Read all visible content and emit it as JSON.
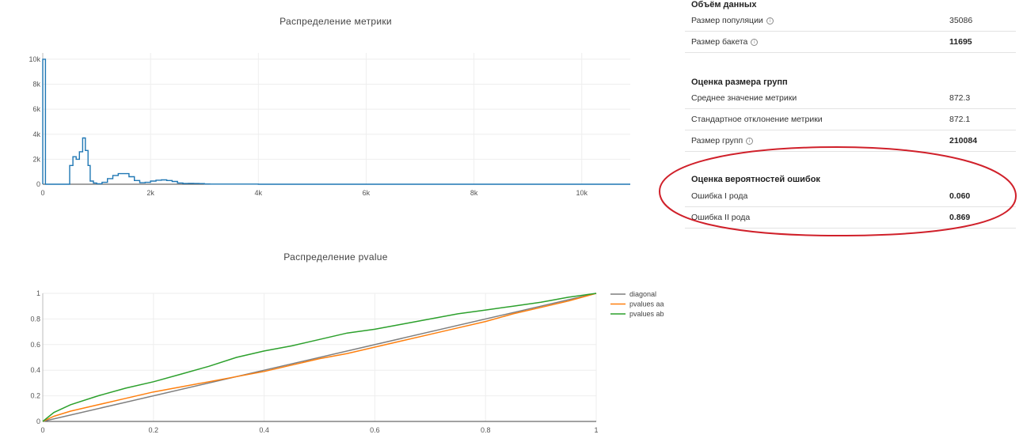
{
  "stats": {
    "data_volume": {
      "title": "Объём данных",
      "rows": [
        {
          "label": "Размер популяции",
          "value": "35086",
          "bold": false,
          "info": true
        },
        {
          "label": "Размер бакета",
          "value": "11695",
          "bold": true,
          "info": true
        }
      ]
    },
    "group_size": {
      "title": "Оценка размера групп",
      "rows": [
        {
          "label": "Среднее значение метрики",
          "value": "872.3",
          "bold": false,
          "info": false
        },
        {
          "label": "Стандартное отклонение метрики",
          "value": "872.1",
          "bold": false,
          "info": false
        },
        {
          "label": "Размер групп",
          "value": "210084",
          "bold": true,
          "info": true
        }
      ]
    },
    "error_rates": {
      "title": "Оценка вероятностей ошибок",
      "rows": [
        {
          "label": "Ошибка I рода",
          "value": "0.060",
          "bold": true,
          "info": false
        },
        {
          "label": "Ошибка II рода",
          "value": "0.869",
          "bold": true,
          "info": false
        }
      ]
    },
    "highlight_color": "#d0202a",
    "info_icon": "info-circle-icon"
  },
  "chart_data": [
    {
      "type": "histogram",
      "title": "Распределение метрики",
      "xlabel": "",
      "ylabel": "",
      "xlim": [
        0,
        10900
      ],
      "ylim": [
        0,
        10500
      ],
      "x_ticks": [
        0,
        2000,
        4000,
        6000,
        8000,
        10000
      ],
      "x_tick_labels": [
        "0",
        "2k",
        "4k",
        "6k",
        "8k",
        "10k"
      ],
      "y_ticks": [
        0,
        2000,
        4000,
        6000,
        8000,
        10000
      ],
      "y_tick_labels": [
        "0",
        "2k",
        "4k",
        "6k",
        "8k",
        "10k"
      ],
      "grid": true,
      "color": "#1f77b4",
      "series": [
        {
          "bins": [
            [
              0,
              50,
              10000
            ],
            [
              50,
              500,
              0
            ],
            [
              500,
              560,
              1500
            ],
            [
              560,
              620,
              2200
            ],
            [
              620,
              680,
              2000
            ],
            [
              680,
              740,
              2600
            ],
            [
              740,
              790,
              3700
            ],
            [
              790,
              840,
              2700
            ],
            [
              840,
              880,
              1500
            ],
            [
              880,
              940,
              250
            ],
            [
              940,
              1000,
              100
            ],
            [
              1000,
              1100,
              40
            ],
            [
              1100,
              1200,
              150
            ],
            [
              1200,
              1300,
              450
            ],
            [
              1300,
              1400,
              700
            ],
            [
              1400,
              1500,
              850
            ],
            [
              1500,
              1600,
              850
            ],
            [
              1600,
              1700,
              600
            ],
            [
              1700,
              1800,
              300
            ],
            [
              1800,
              1900,
              120
            ],
            [
              1900,
              2000,
              150
            ],
            [
              2000,
              2100,
              250
            ],
            [
              2100,
              2200,
              320
            ],
            [
              2200,
              2300,
              350
            ],
            [
              2300,
              2400,
              300
            ],
            [
              2400,
              2500,
              220
            ],
            [
              2500,
              2600,
              100
            ],
            [
              2600,
              2700,
              60
            ],
            [
              2700,
              2800,
              70
            ],
            [
              2800,
              2900,
              60
            ],
            [
              2900,
              3000,
              50
            ],
            [
              3000,
              3100,
              20
            ],
            [
              3100,
              4000,
              10
            ],
            [
              4000,
              10900,
              0
            ]
          ]
        }
      ]
    },
    {
      "type": "line",
      "title": "Распределение pvalue",
      "xlabel": "",
      "ylabel": "",
      "xlim": [
        0,
        1
      ],
      "ylim": [
        0,
        1
      ],
      "x_ticks": [
        0,
        0.2,
        0.4,
        0.6,
        0.8,
        1
      ],
      "x_tick_labels": [
        "0",
        "0.2",
        "0.4",
        "0.6",
        "0.8",
        "1"
      ],
      "y_ticks": [
        0,
        0.2,
        0.4,
        0.6,
        0.8,
        1
      ],
      "y_tick_labels": [
        "0",
        "0.2",
        "0.4",
        "0.6",
        "0.8",
        "1"
      ],
      "grid": true,
      "legend": "right",
      "series": [
        {
          "name": "diagonal",
          "color": "#7f7f7f",
          "x": [
            0,
            1
          ],
          "y": [
            0,
            1
          ]
        },
        {
          "name": "pvalues aa",
          "color": "#ff7f0e",
          "x": [
            0,
            0.02,
            0.05,
            0.1,
            0.15,
            0.2,
            0.25,
            0.3,
            0.35,
            0.4,
            0.45,
            0.5,
            0.55,
            0.6,
            0.65,
            0.7,
            0.75,
            0.8,
            0.85,
            0.9,
            0.95,
            1
          ],
          "y": [
            0,
            0.04,
            0.08,
            0.13,
            0.18,
            0.23,
            0.27,
            0.31,
            0.35,
            0.39,
            0.44,
            0.49,
            0.53,
            0.58,
            0.63,
            0.68,
            0.73,
            0.78,
            0.84,
            0.89,
            0.94,
            1
          ]
        },
        {
          "name": "pvalues ab",
          "color": "#2ca02c",
          "x": [
            0,
            0.02,
            0.05,
            0.1,
            0.15,
            0.2,
            0.25,
            0.3,
            0.35,
            0.4,
            0.45,
            0.5,
            0.55,
            0.6,
            0.65,
            0.7,
            0.75,
            0.8,
            0.85,
            0.9,
            0.95,
            1
          ],
          "y": [
            0,
            0.07,
            0.13,
            0.2,
            0.26,
            0.31,
            0.37,
            0.43,
            0.5,
            0.55,
            0.59,
            0.64,
            0.69,
            0.72,
            0.76,
            0.8,
            0.84,
            0.87,
            0.9,
            0.93,
            0.97,
            1
          ]
        }
      ]
    }
  ]
}
